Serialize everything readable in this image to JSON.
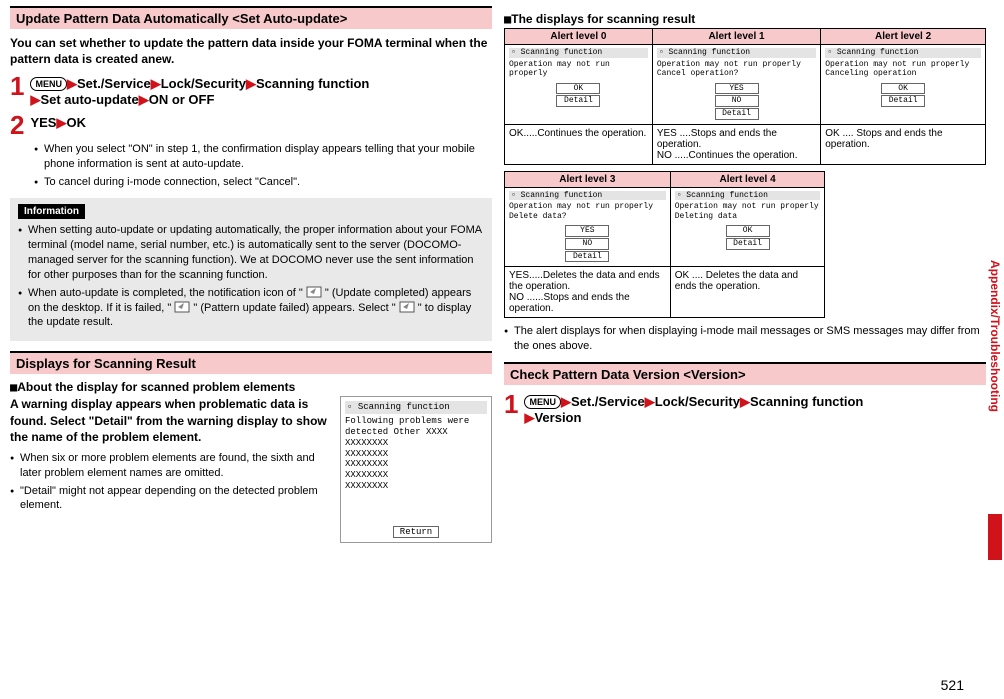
{
  "left": {
    "heading1": "Update Pattern Data Automatically <Set Auto-update>",
    "intro": "You can set whether to update the pattern data inside your FOMA terminal when the pattern data is created anew.",
    "step1": {
      "menu": "MENU",
      "a": "Set./Service",
      "b": "Lock/Security",
      "c": "Scanning function",
      "d": "Set auto-update",
      "e": "ON or OFF"
    },
    "step2": {
      "a": "YES",
      "b": "OK"
    },
    "step2bullets": [
      "When you select \"ON\" in step 1, the confirmation display appears telling that your mobile phone information is sent at auto-update.",
      "To cancel during i-mode connection, select \"Cancel\"."
    ],
    "info_label": "Information",
    "info": [
      "When setting auto-update or updating automatically, the proper information about your FOMA terminal (model name, serial number, etc.) is automatically sent to the server (DOCOMO-managed server for the scanning function). We at DOCOMO never use the sent information for other purposes than for the scanning function.",
      "When auto-update is completed, the notification icon of \"  \" (Update completed) appears on the desktop. If it is failed, \"  \" (Pattern update failed) appears. Select \"  \" to display the update result."
    ],
    "heading2": "Displays for Scanning Result",
    "sub_h": "About the display for scanned problem elements",
    "desc_bold": "A warning display appears when problematic data is found. Select \"Detail\" from the warning display to show the name of the problem element.",
    "desc_b1": "When six or more problem elements are found, the sixth and later problem element names are omitted.",
    "desc_b2": "\"Detail\" might not appear depending on the detected problem element.",
    "shot": {
      "title": "Scanning function",
      "l1": "Following problems were",
      "l2": "detected        Other XXXX",
      "x": "XXXXXXXX",
      "return": "Return"
    }
  },
  "right": {
    "sub_h": "The displays for scanning result",
    "th0": "Alert level 0",
    "th1": "Alert level 1",
    "th2": "Alert level 2",
    "th3": "Alert level 3",
    "th4": "Alert level 4",
    "shot_title": "Scanning function",
    "msg_base": "Operation may not run properly",
    "msg1_extra": "Cancel operation?",
    "msg2_extra": "Canceling operation",
    "msg3_extra": "Delete data?",
    "msg4_extra": "Deleting data",
    "btn_ok": "OK",
    "btn_detail": "Detail",
    "btn_yes": "YES",
    "btn_no": "NO",
    "d0": "OK.....Continues the operation.",
    "d1a": "YES ....Stops and ends the operation.",
    "d1b": "NO  .....Continues the operation.",
    "d2": "OK .... Stops and ends the operation.",
    "d3a": "YES.....Deletes the data and ends the operation.",
    "d3b": "NO ......Stops and ends the operation.",
    "d4": "OK .... Deletes the data and ends the operation.",
    "note": "The alert displays for when displaying i-mode mail messages or SMS messages may differ from the ones above.",
    "heading3": "Check Pattern Data Version <Version>",
    "step3": {
      "menu": "MENU",
      "a": "Set./Service",
      "b": "Lock/Security",
      "c": "Scanning function",
      "d": "Version"
    }
  },
  "sidetab": "Appendix/Troubleshooting",
  "pagenum": "521"
}
